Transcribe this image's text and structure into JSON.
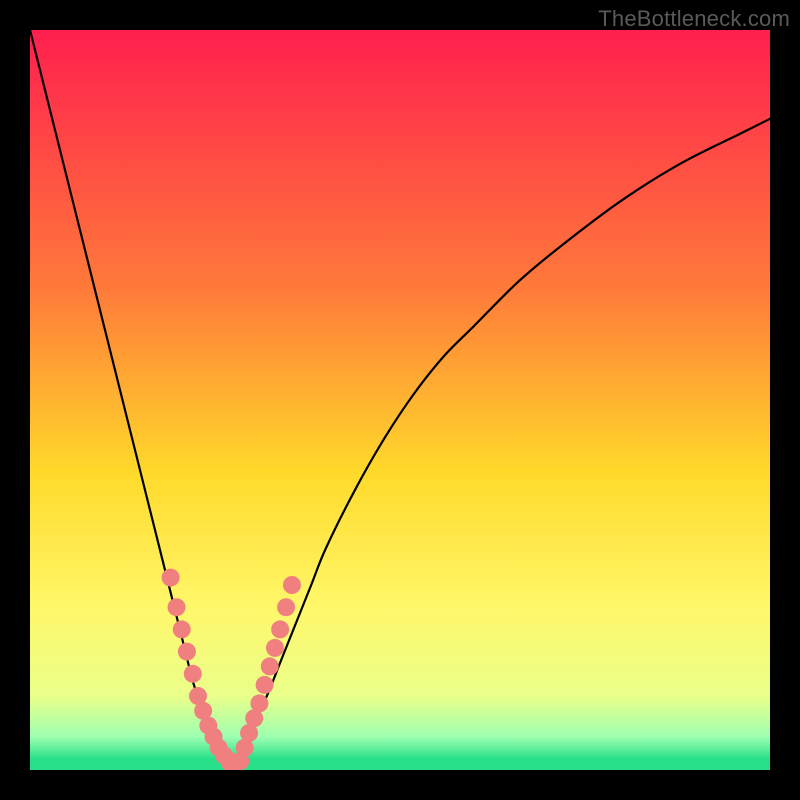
{
  "watermark": {
    "text": "TheBottleneck.com"
  },
  "chart_data": {
    "type": "line",
    "title": "",
    "xlabel": "",
    "ylabel": "",
    "xlim": [
      0,
      100
    ],
    "ylim": [
      0,
      100
    ],
    "grid": false,
    "legend": false,
    "background": {
      "type": "vertical-gradient",
      "stops": [
        {
          "pos": 0.0,
          "color": "#ff1f4e"
        },
        {
          "pos": 0.35,
          "color": "#ff7a3a"
        },
        {
          "pos": 0.6,
          "color": "#ffda2a"
        },
        {
          "pos": 0.78,
          "color": "#fff76a"
        },
        {
          "pos": 0.9,
          "color": "#eaff8a"
        },
        {
          "pos": 0.955,
          "color": "#9dffb0"
        },
        {
          "pos": 0.985,
          "color": "#29e08a"
        },
        {
          "pos": 1.0,
          "color": "#29e08a"
        }
      ]
    },
    "series": [
      {
        "name": "left-branch",
        "color": "#000000",
        "width": 2.2,
        "x": [
          0,
          2,
          4,
          6,
          8,
          10,
          12,
          14,
          16,
          18,
          20,
          21,
          22,
          23,
          24,
          25,
          26,
          27
        ],
        "y": [
          100,
          92,
          84,
          76,
          68,
          60,
          52,
          44,
          36,
          28,
          20,
          16,
          12,
          9,
          6,
          4,
          2,
          1
        ]
      },
      {
        "name": "right-branch",
        "color": "#000000",
        "width": 2.2,
        "x": [
          27,
          28,
          29,
          30,
          32,
          34,
          36,
          38,
          40,
          44,
          48,
          52,
          56,
          60,
          66,
          72,
          80,
          88,
          96,
          100
        ],
        "y": [
          1,
          2,
          4,
          6,
          10,
          15,
          20,
          25,
          30,
          38,
          45,
          51,
          56,
          60,
          66,
          71,
          77,
          82,
          86,
          88
        ]
      }
    ],
    "marker_clusters": [
      {
        "name": "left-cluster",
        "color": "#f08080",
        "radius": 9,
        "points": [
          {
            "x": 19.0,
            "y": 26
          },
          {
            "x": 19.8,
            "y": 22
          },
          {
            "x": 20.5,
            "y": 19
          },
          {
            "x": 21.2,
            "y": 16
          },
          {
            "x": 22.0,
            "y": 13
          },
          {
            "x": 22.7,
            "y": 10
          },
          {
            "x": 23.4,
            "y": 8
          },
          {
            "x": 24.1,
            "y": 6
          },
          {
            "x": 24.8,
            "y": 4.5
          },
          {
            "x": 25.5,
            "y": 3
          },
          {
            "x": 26.2,
            "y": 2
          },
          {
            "x": 26.9,
            "y": 1.3
          }
        ]
      },
      {
        "name": "bottom-cluster",
        "color": "#f08080",
        "radius": 9,
        "points": [
          {
            "x": 27.0,
            "y": 1.0
          },
          {
            "x": 27.7,
            "y": 1.0
          },
          {
            "x": 28.4,
            "y": 1.2
          }
        ]
      },
      {
        "name": "right-cluster",
        "color": "#f08080",
        "radius": 9,
        "points": [
          {
            "x": 29.0,
            "y": 3
          },
          {
            "x": 29.6,
            "y": 5
          },
          {
            "x": 30.3,
            "y": 7
          },
          {
            "x": 31.0,
            "y": 9
          },
          {
            "x": 31.7,
            "y": 11.5
          },
          {
            "x": 32.4,
            "y": 14
          },
          {
            "x": 33.1,
            "y": 16.5
          },
          {
            "x": 33.8,
            "y": 19
          },
          {
            "x": 34.6,
            "y": 22
          },
          {
            "x": 35.4,
            "y": 25
          }
        ]
      }
    ]
  }
}
